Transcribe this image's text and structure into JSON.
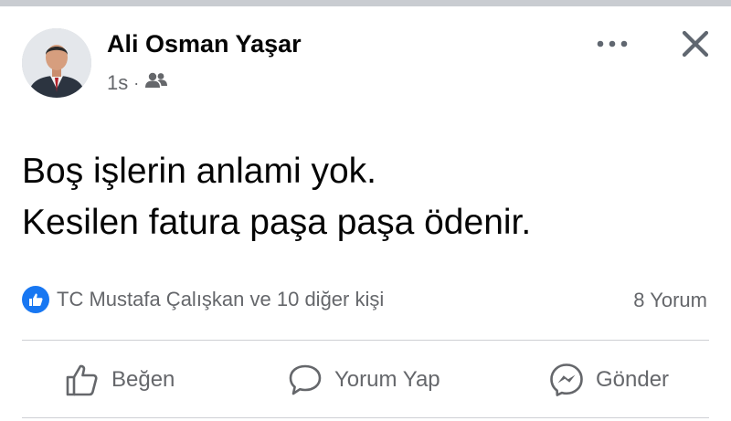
{
  "post": {
    "author_name": "Ali Osman Yaşar",
    "timestamp": "1s",
    "separator": "·",
    "audience_icon": "friends-icon",
    "text_lines": [
      "Boş işlerin anlami yok.",
      "Kesilen fatura paşa paşa ödenir."
    ]
  },
  "reactions": {
    "icon": "like-icon",
    "summary": "TC Mustafa Çalışkan ve 10 diğer kişi",
    "comment_count": "8 Yorum"
  },
  "actions": [
    {
      "label": "Beğen",
      "icon": "thumbs-up-icon"
    },
    {
      "label": "Yorum Yap",
      "icon": "comment-icon"
    },
    {
      "label": "Gönder",
      "icon": "messenger-icon"
    }
  ],
  "colors": {
    "accent": "#1877f2",
    "secondary_text": "#65676b",
    "primary_text": "#050505",
    "divider": "#ced0d4"
  }
}
